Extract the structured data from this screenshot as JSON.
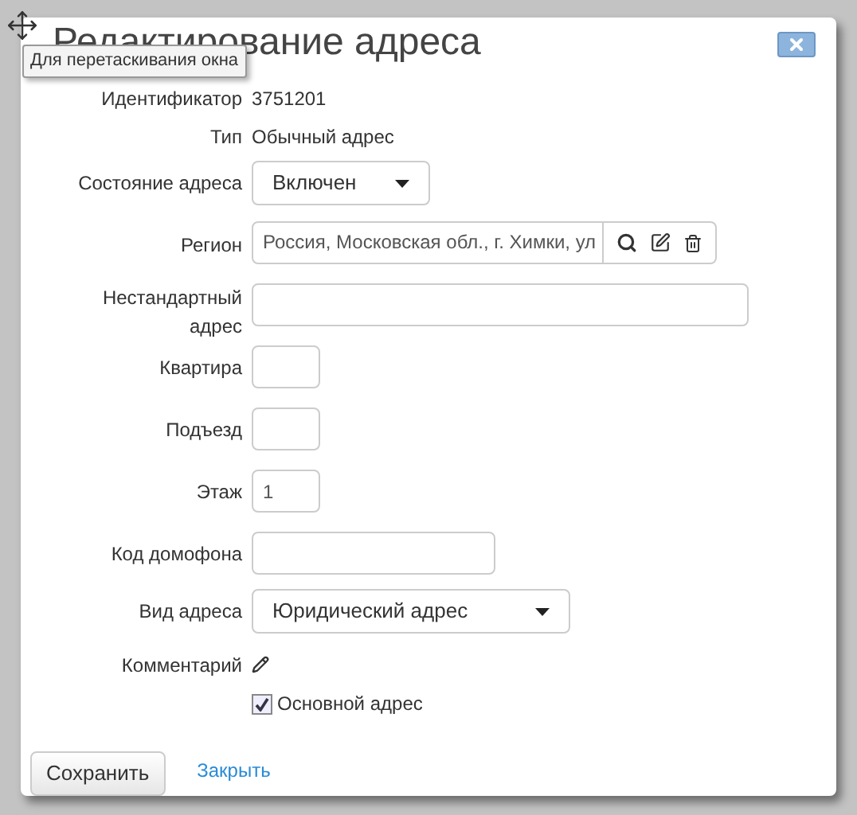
{
  "dialog": {
    "title": "Редактирование адреса",
    "tooltip": "Для перетаскивания окна"
  },
  "rows": [
    {
      "kind": "text",
      "label": "Идентификатор",
      "value": "3751201"
    },
    {
      "kind": "text",
      "label": "Тип",
      "value": "Обычный адрес"
    },
    {
      "kind": "short_select",
      "label": "Состояние адреса",
      "value": "Включен"
    },
    {
      "kind": "region",
      "label": "Регион",
      "value": "Россия, Московская обл., г. Химки, ул"
    },
    {
      "kind": "wide_input",
      "label": "Нестандартный адрес",
      "value": ""
    },
    {
      "kind": "tiny_input",
      "label": "Квартира",
      "value": ""
    },
    {
      "kind": "tiny_input",
      "label": "Подъезд",
      "value": ""
    },
    {
      "kind": "tiny_input",
      "label": "Этаж",
      "value": "1"
    },
    {
      "kind": "medium_input",
      "label": "Код домофона",
      "value": ""
    },
    {
      "kind": "long_select",
      "label": "Вид адреса",
      "value": "Юридический адрес"
    },
    {
      "kind": "comment",
      "label": "Комментарий"
    },
    {
      "kind": "checkbox",
      "label": "Основной адрес",
      "checked": true
    }
  ],
  "buttons": {
    "save": "Сохранить",
    "close": "Закрыть"
  }
}
